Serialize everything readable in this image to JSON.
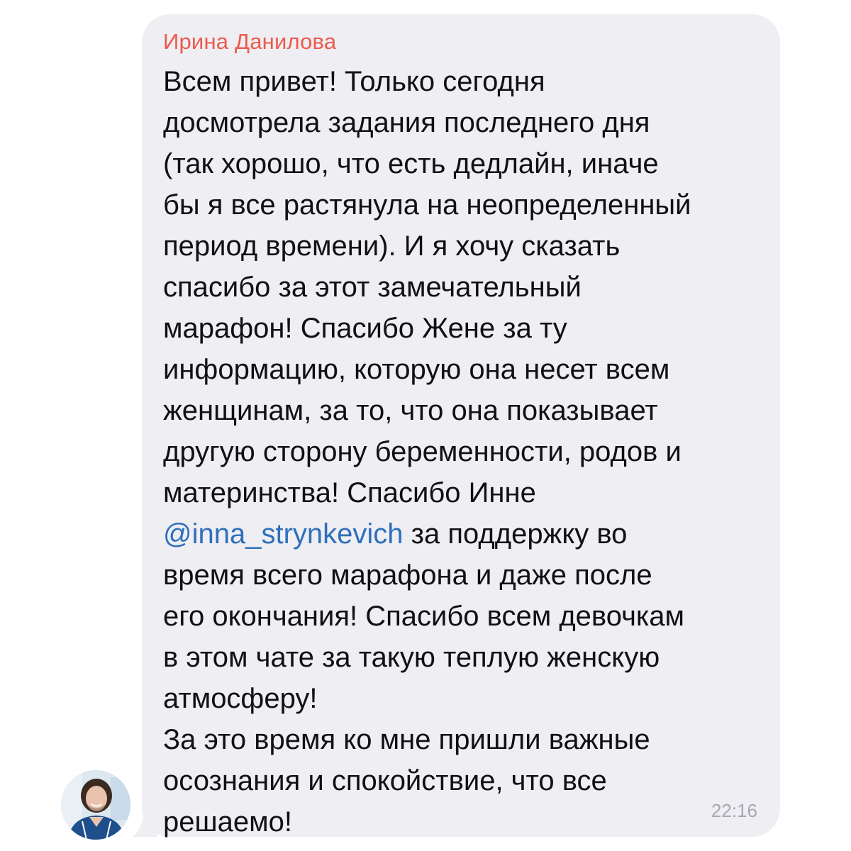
{
  "message": {
    "sender_name": "Ирина Данилова",
    "lines_before_mention": [
      "Всем привет! Только сегодня",
      "досмотрела задания последнего дня",
      "(так хорошо, что есть дедлайн, иначе",
      "бы я все растянула на неопределенный",
      "период времени). И я хочу сказать",
      "спасибо за этот замечательный",
      "марафон! Спасибо Жене за ту",
      "информацию, которую она несет всем",
      "женщинам, за то, что она показывает",
      "другую сторону беременности, родов и",
      "материнства! Спасибо Инне"
    ],
    "mention": "@inna_strynkevich",
    "mention_line_rest": " за поддержку во",
    "lines_after_mention": [
      "время всего марафона и даже после",
      "его окончания! Спасибо всем девочкам",
      "в этом чате за такую теплую женскую",
      "атмосферу!",
      "За это время ко мне пришли важные",
      "осознания и спокойствие, что все",
      "решаемо!"
    ],
    "time": "22:16"
  },
  "colors": {
    "bubble": "#eeeef3",
    "sender_name": "#ec5b4d",
    "mention": "#2f6fbc",
    "timestamp": "#a6a9b3"
  }
}
